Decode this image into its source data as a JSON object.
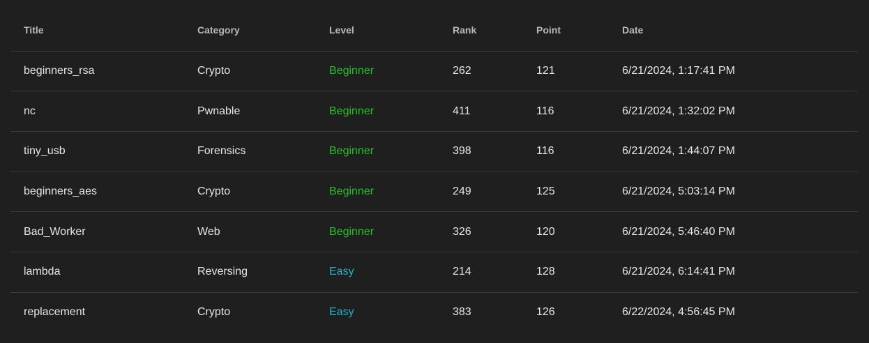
{
  "columns": {
    "title": "Title",
    "category": "Category",
    "level": "Level",
    "rank": "Rank",
    "point": "Point",
    "date": "Date"
  },
  "colors": {
    "background": "#1f1f1f",
    "beginner": "#22c322",
    "easy": "#1fb3c9"
  },
  "rows": [
    {
      "title": "beginners_rsa",
      "category": "Crypto",
      "level": "Beginner",
      "rank": "262",
      "point": "121",
      "date": "6/21/2024, 1:17:41 PM"
    },
    {
      "title": "nc",
      "category": "Pwnable",
      "level": "Beginner",
      "rank": "411",
      "point": "116",
      "date": "6/21/2024, 1:32:02 PM"
    },
    {
      "title": "tiny_usb",
      "category": "Forensics",
      "level": "Beginner",
      "rank": "398",
      "point": "116",
      "date": "6/21/2024, 1:44:07 PM"
    },
    {
      "title": "beginners_aes",
      "category": "Crypto",
      "level": "Beginner",
      "rank": "249",
      "point": "125",
      "date": "6/21/2024, 5:03:14 PM"
    },
    {
      "title": "Bad_Worker",
      "category": "Web",
      "level": "Beginner",
      "rank": "326",
      "point": "120",
      "date": "6/21/2024, 5:46:40 PM"
    },
    {
      "title": "lambda",
      "category": "Reversing",
      "level": "Easy",
      "rank": "214",
      "point": "128",
      "date": "6/21/2024, 6:14:41 PM"
    },
    {
      "title": "replacement",
      "category": "Crypto",
      "level": "Easy",
      "rank": "383",
      "point": "126",
      "date": "6/22/2024, 4:56:45 PM"
    }
  ]
}
